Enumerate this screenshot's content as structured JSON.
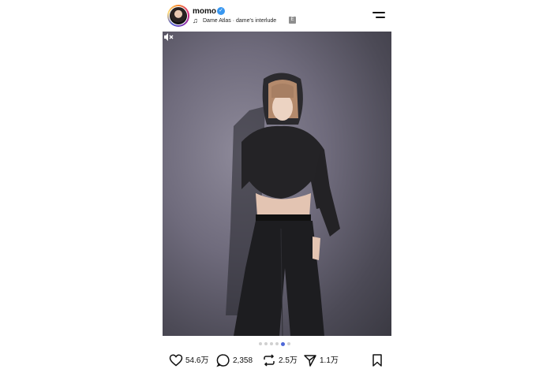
{
  "header": {
    "username": "momo",
    "music_title": "Dame Atlas · dame's interlude",
    "explicit_badge": "E"
  },
  "carousel": {
    "slide_count": 6,
    "active_index": 4
  },
  "actions": {
    "likes": "54.6万",
    "comments": "2,358",
    "reposts": "2.5万",
    "shares": "1.1万"
  },
  "icons": [
    "verified-icon",
    "music-note-icon",
    "menu-icon",
    "mute-icon",
    "heart-icon",
    "comment-icon",
    "repost-icon",
    "share-icon",
    "bookmark-icon"
  ],
  "colors": {
    "verified": "#3897f0",
    "active_dot": "#4e68d8"
  }
}
